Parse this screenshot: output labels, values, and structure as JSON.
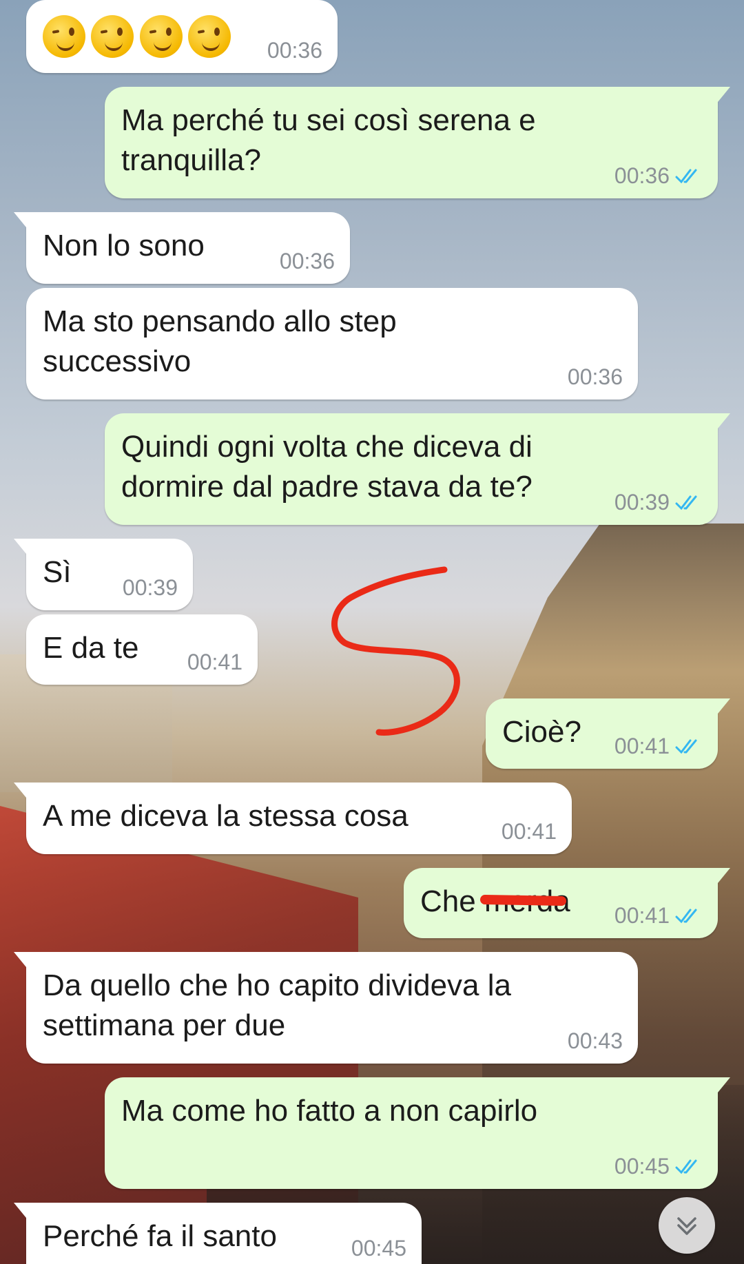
{
  "chat": {
    "messages": [
      {
        "direction": "incoming",
        "text": "",
        "emoji": [
          "winking-face",
          "winking-face",
          "winking-face",
          "winking-face"
        ],
        "time": "00:36"
      },
      {
        "direction": "outgoing",
        "text": "Ma perché tu sei così serena e\ntranquilla?",
        "time": "00:36",
        "status": "read"
      },
      {
        "direction": "incoming",
        "text": "Non lo sono",
        "time": "00:36"
      },
      {
        "direction": "incoming",
        "text": "Ma sto pensando allo step\nsuccessivo",
        "time": "00:36"
      },
      {
        "direction": "outgoing",
        "text": "Quindi ogni volta che diceva di\ndormire dal padre stava da te?",
        "time": "00:39",
        "status": "read"
      },
      {
        "direction": "incoming",
        "text": "Sì",
        "time": "00:39"
      },
      {
        "direction": "incoming",
        "text": "E da te",
        "time": "00:41"
      },
      {
        "direction": "outgoing",
        "text": "Cioè?",
        "time": "00:41",
        "status": "read"
      },
      {
        "direction": "incoming",
        "text": "A me diceva la stessa cosa",
        "time": "00:41"
      },
      {
        "direction": "outgoing",
        "text": "Che merda",
        "time": "00:41",
        "status": "read",
        "redacted_part": "merd"
      },
      {
        "direction": "incoming",
        "text": "Da quello che ho capito divideva la\nsettimana per due",
        "time": "00:43"
      },
      {
        "direction": "outgoing",
        "text": "Ma come ho fatto a non capirlo",
        "time": "00:45",
        "status": "read"
      },
      {
        "direction": "incoming",
        "text": "Perché fa il santo",
        "time": "00:45"
      }
    ]
  },
  "annotations": {
    "scribble": "red-s-scribble",
    "strikethrough": "red-strikethrough",
    "color": "#ea2a17"
  },
  "scroll_button": {
    "icon": "double-chevron-down-icon"
  },
  "colors": {
    "incoming_bubble": "#ffffff",
    "outgoing_bubble": "#e4fcd6",
    "timestamp": "#8b9096",
    "read_ticks": "#34b7f1"
  }
}
